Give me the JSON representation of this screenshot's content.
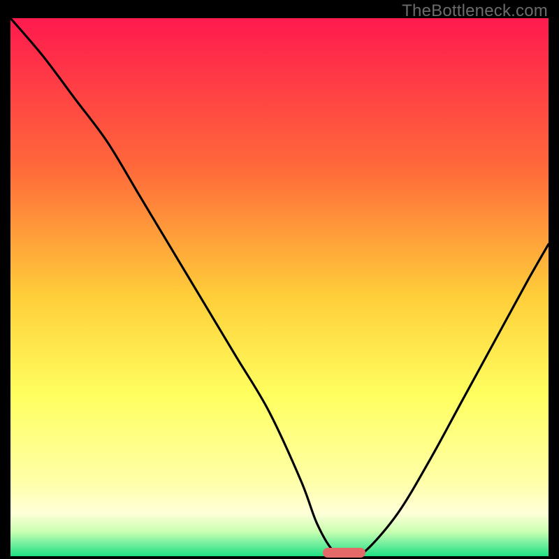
{
  "watermark": "TheBottleneck.com",
  "colors": {
    "bg": "#000000",
    "grad_top": "#ff1a4e",
    "grad_mid1": "#ff7a3a",
    "grad_mid2": "#ffd23a",
    "grad_mid3": "#ffff60",
    "grad_low1": "#ffffb8",
    "grad_low2": "#c9ffb0",
    "grad_bottom": "#1fe083",
    "curve": "#000000",
    "marker": "#e46a6a"
  },
  "chart_data": {
    "type": "line",
    "title": "",
    "xlabel": "",
    "ylabel": "",
    "xlim": [
      0,
      100
    ],
    "ylim": [
      0,
      100
    ],
    "grid": false,
    "legend": false,
    "annotations": [
      "TheBottleneck.com"
    ],
    "series": [
      {
        "name": "bottleneck-curve",
        "x": [
          0,
          6,
          12,
          18,
          24,
          30,
          36,
          42,
          48,
          54,
          57,
          60,
          63,
          66,
          72,
          78,
          84,
          90,
          96,
          100
        ],
        "values": [
          100,
          93,
          85,
          77,
          67,
          57,
          47,
          37,
          27,
          14,
          6,
          1,
          0,
          1,
          8,
          18,
          29,
          40,
          51,
          58
        ]
      }
    ],
    "marker": {
      "x_start": 58,
      "x_end": 66,
      "y": 0
    },
    "gradient_stops_pct": [
      {
        "pct": 0,
        "color": "#ff1a4e"
      },
      {
        "pct": 28,
        "color": "#ff6a3a"
      },
      {
        "pct": 52,
        "color": "#ffcf3a"
      },
      {
        "pct": 70,
        "color": "#ffff60"
      },
      {
        "pct": 86,
        "color": "#ffffa8"
      },
      {
        "pct": 92,
        "color": "#ffffd8"
      },
      {
        "pct": 95.5,
        "color": "#c8ffb0"
      },
      {
        "pct": 97.5,
        "color": "#7af0a0"
      },
      {
        "pct": 100,
        "color": "#1fe083"
      }
    ]
  }
}
